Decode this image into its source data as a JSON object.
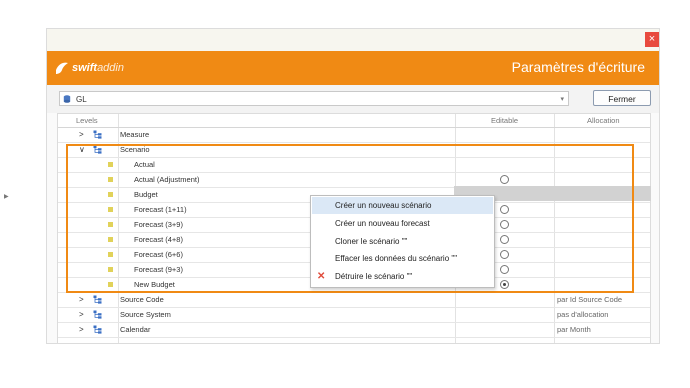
{
  "window": {
    "title": "Paramètres d'écriture",
    "close_glyph": "×",
    "header_color": "#f08a14",
    "logo": {
      "name": "swiftaddin",
      "text_bold": "swift",
      "text_light": "addin"
    }
  },
  "toolbar": {
    "combo_value": "GL",
    "combo_icon": "database-icon",
    "combo_arrow": "▾",
    "close_button": "Fermer"
  },
  "grid": {
    "columns": {
      "levels": "Levels",
      "editable": "Editable",
      "allocation": "Allocation"
    },
    "rows": [
      {
        "type": "dimension",
        "label": "Measure",
        "expander": ">",
        "allocation": ""
      },
      {
        "type": "dimension",
        "label": "Scenario",
        "expander": "∨",
        "allocation": ""
      },
      {
        "type": "member",
        "label": "Actual",
        "radio": "none"
      },
      {
        "type": "member",
        "label": "Actual (Adjustment)",
        "radio": "empty"
      },
      {
        "type": "member",
        "label": "Budget",
        "radio": "empty",
        "selected": true
      },
      {
        "type": "member",
        "label": "Forecast (1+11)",
        "radio": "empty"
      },
      {
        "type": "member",
        "label": "Forecast (3+9)",
        "radio": "empty"
      },
      {
        "type": "member",
        "label": "Forecast (4+8)",
        "radio": "empty"
      },
      {
        "type": "member",
        "label": "Forecast (6+6)",
        "radio": "empty"
      },
      {
        "type": "member",
        "label": "Forecast (9+3)",
        "radio": "empty"
      },
      {
        "type": "member",
        "label": "New Budget",
        "radio": "checked"
      },
      {
        "type": "dimension",
        "label": "Source Code",
        "expander": ">",
        "allocation": "par Id Source Code"
      },
      {
        "type": "dimension",
        "label": "Source System",
        "expander": ">",
        "allocation": "pas d'allocation"
      },
      {
        "type": "dimension",
        "label": "Calendar",
        "expander": ">",
        "allocation": "par Month"
      }
    ],
    "row_pointer": "▶",
    "highlight_color": "#f08a14"
  },
  "context_menu": {
    "items": [
      {
        "label": "Créer un nouveau scénario",
        "highlighted": true
      },
      {
        "label": "Créer un nouveau forecast"
      },
      {
        "label": "Cloner le scénario \"\""
      },
      {
        "label": "Effacer les  données du  scénario \"\""
      },
      {
        "label": "Détruire le scénario \"\"",
        "icon": "delete-x-icon",
        "icon_glyph": "✕"
      }
    ]
  }
}
